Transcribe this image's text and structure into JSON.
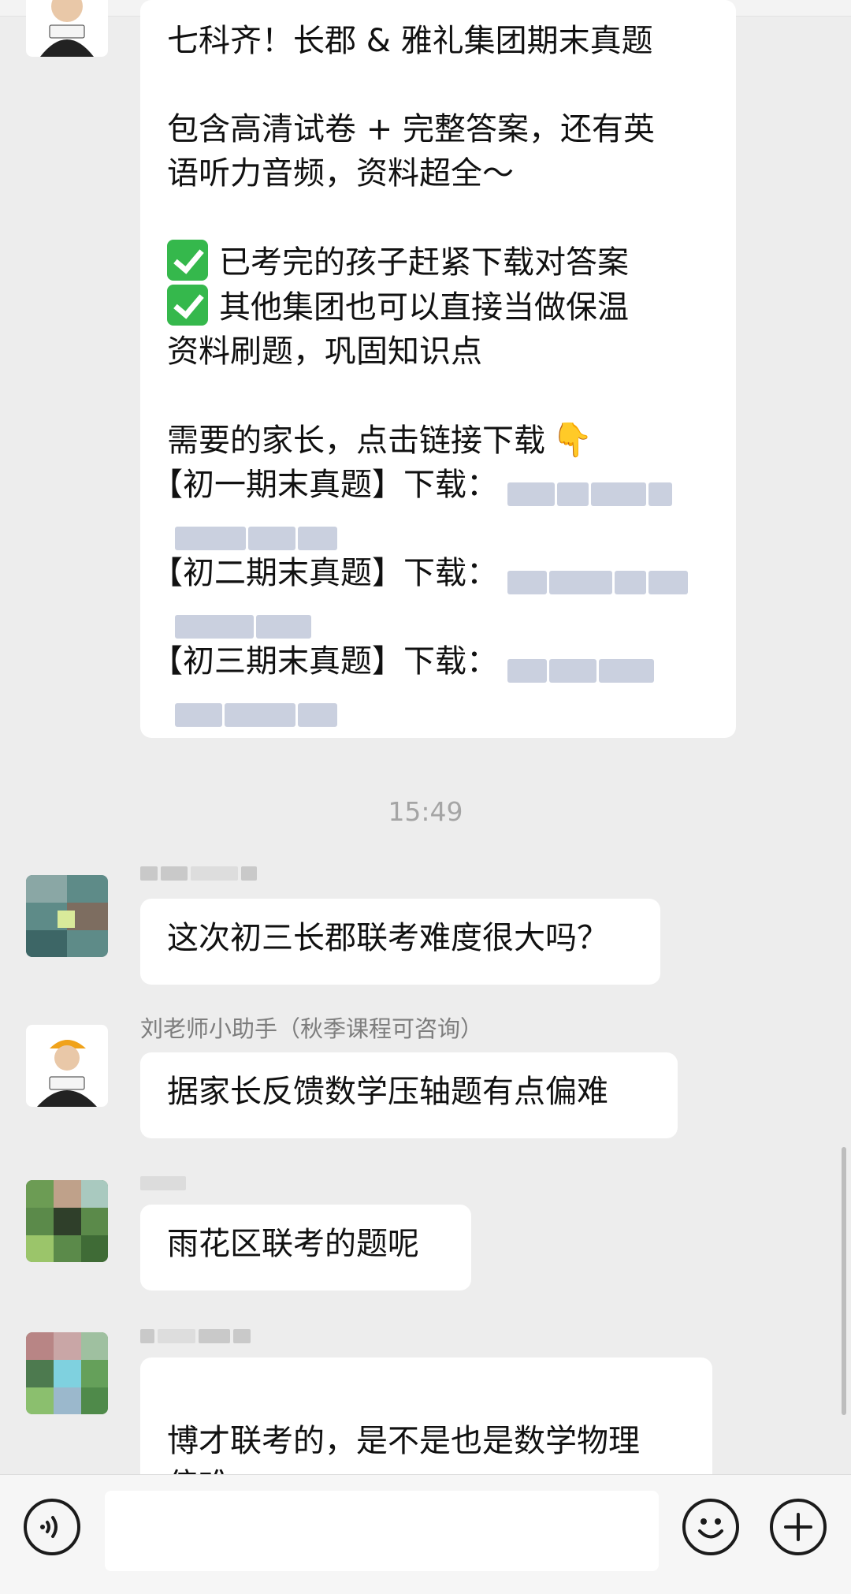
{
  "messages": [
    {
      "lines": [
        "七科齐！长郡 & 雅礼集团期末真题",
        "",
        "包含高清试卷 + 完整答案，还有英",
        "语听力音频，资料超全～",
        ""
      ],
      "check_items": [
        "已考完的孩子赶紧下载对答案",
        "其他集团也可以直接当做保温"
      ],
      "check_continuation": "资料刷题，巩固知识点",
      "cta": "需要的家长，点击链接下载",
      "cta_icon": "pointing-down-hand-icon",
      "downloads": [
        "【初一期末真题】下载：",
        "【初二期末真题】下载：",
        "【初三期末真题】下载："
      ]
    }
  ],
  "timestamp": "15:49",
  "chat": [
    {
      "sender": "",
      "text": "这次初三长郡联考难度很大吗？"
    },
    {
      "sender": "刘老师小助手（秋季课程可咨询）",
      "text": "据家长反馈数学压轴题有点偏难"
    },
    {
      "sender": "",
      "text": "雨花区联考的题呢"
    },
    {
      "sender": "",
      "text": "博才联考的，是不是也是数学物理\n偏难"
    }
  ],
  "input": {
    "value": ""
  },
  "icons": {
    "voice": "voice-icon",
    "emoji": "emoji-icon",
    "plus": "plus-icon"
  },
  "colors": {
    "background": "#ededed",
    "bubble": "#ffffff",
    "check": "#35b84c",
    "meta_text": "#a5a5a5"
  }
}
